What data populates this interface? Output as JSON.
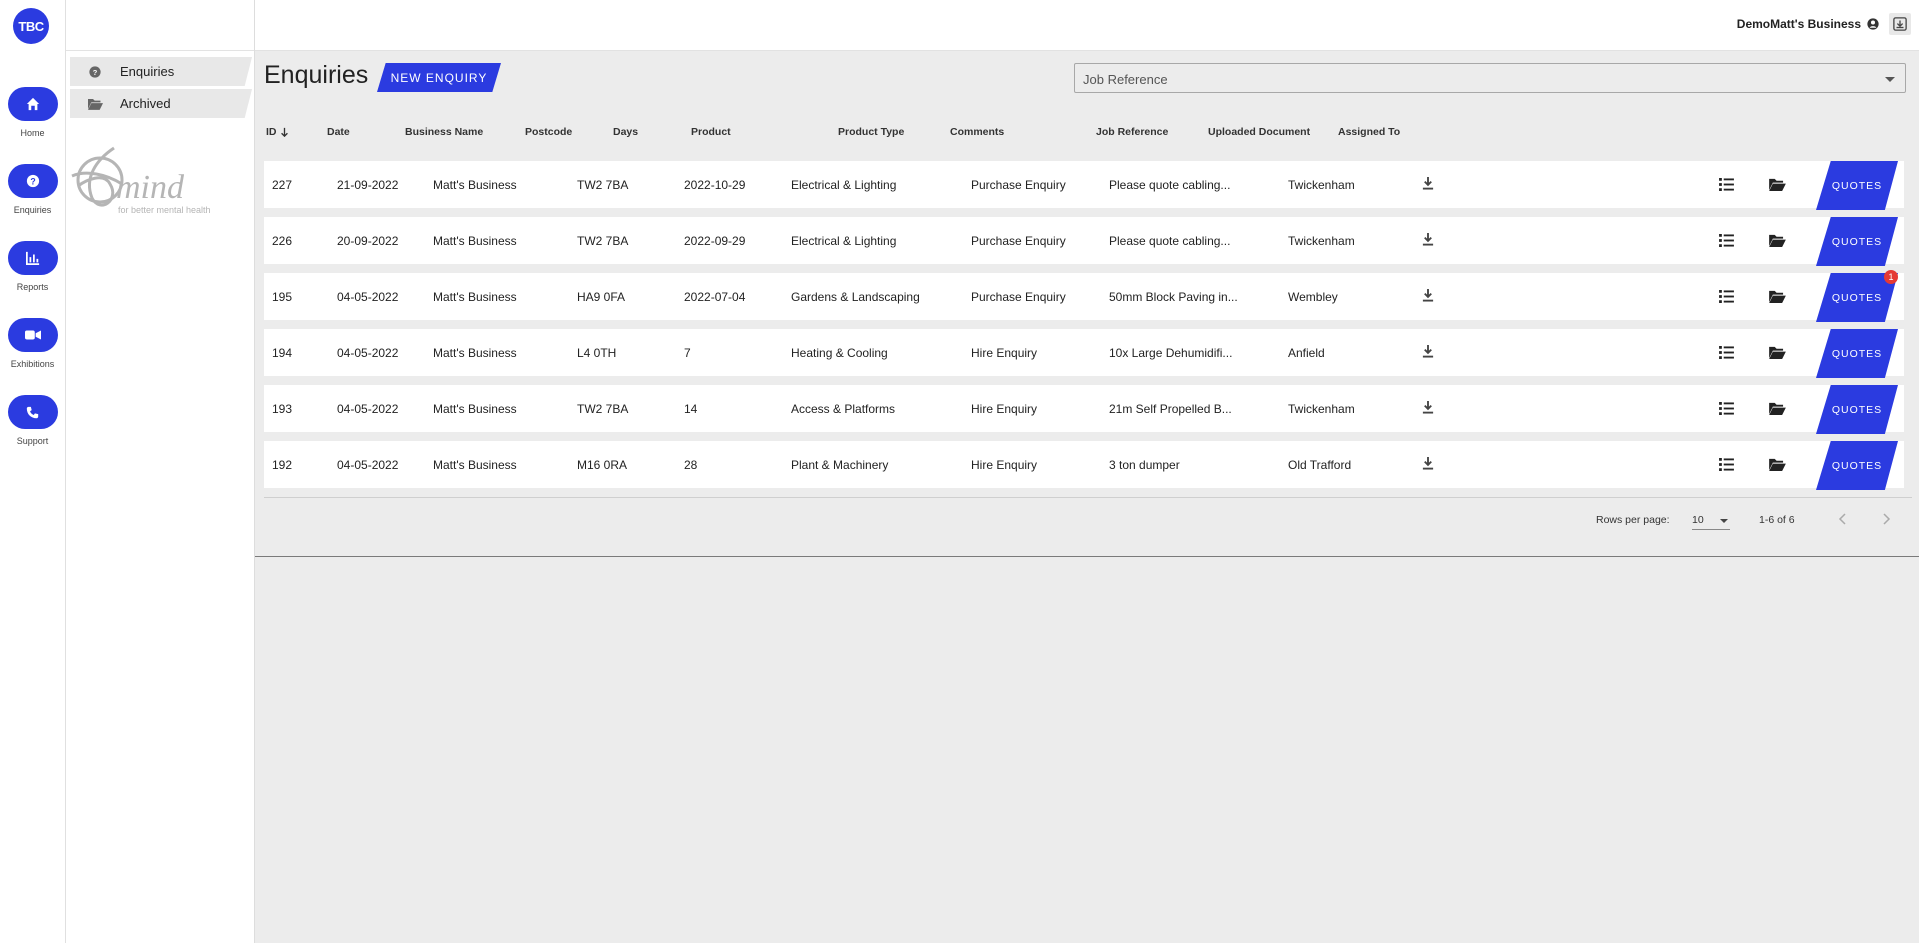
{
  "app": {
    "logo_text": "TBC"
  },
  "rail": {
    "items": [
      {
        "label": "Home",
        "icon": "home-icon"
      },
      {
        "label": "Enquiries",
        "icon": "question-icon"
      },
      {
        "label": "Reports",
        "icon": "bar-chart-icon"
      },
      {
        "label": "Exhibitions",
        "icon": "video-icon"
      },
      {
        "label": "Support",
        "icon": "phone-icon"
      }
    ]
  },
  "subnav": {
    "items": [
      {
        "label": "Enquiries",
        "icon": "question-icon"
      },
      {
        "label": "Archived",
        "icon": "folder-open-icon"
      }
    ],
    "charity_logo": {
      "name": "mind",
      "tagline": "for better mental health"
    }
  },
  "header": {
    "account_name": "DemoMatt's Business"
  },
  "main": {
    "title": "Enquiries",
    "new_button": "NEW ENQUIRY",
    "job_reference_placeholder": "Job Reference"
  },
  "table": {
    "columns": [
      "ID",
      "Date",
      "Business Name",
      "Postcode",
      "Days",
      "Product",
      "Product Type",
      "Comments",
      "Job Reference",
      "Uploaded Document",
      "Assigned To"
    ],
    "quotes_label": "QUOTES",
    "rows": [
      {
        "id": "227",
        "date": "21-09-2022",
        "business": "Matt's Business",
        "postcode": "TW2 7BA",
        "days": "2022-10-29",
        "product": "Electrical & Lighting",
        "type": "Purchase Enquiry",
        "comments": "Please quote cabling...",
        "jobref": "Twickenham",
        "badge": ""
      },
      {
        "id": "226",
        "date": "20-09-2022",
        "business": "Matt's Business",
        "postcode": "TW2 7BA",
        "days": "2022-09-29",
        "product": "Electrical & Lighting",
        "type": "Purchase Enquiry",
        "comments": "Please quote cabling...",
        "jobref": "Twickenham",
        "badge": ""
      },
      {
        "id": "195",
        "date": "04-05-2022",
        "business": "Matt's Business",
        "postcode": "HA9 0FA",
        "days": "2022-07-04",
        "product": "Gardens & Landscaping",
        "type": "Purchase Enquiry",
        "comments": "50mm Block Paving in...",
        "jobref": "Wembley",
        "badge": "1"
      },
      {
        "id": "194",
        "date": "04-05-2022",
        "business": "Matt's Business",
        "postcode": "L4 0TH",
        "days": "7",
        "product": "Heating & Cooling",
        "type": "Hire Enquiry",
        "comments": "10x Large Dehumidifi...",
        "jobref": "Anfield",
        "badge": ""
      },
      {
        "id": "193",
        "date": "04-05-2022",
        "business": "Matt's Business",
        "postcode": "TW2 7BA",
        "days": "14",
        "product": "Access & Platforms",
        "type": "Hire Enquiry",
        "comments": "21m Self Propelled B...",
        "jobref": "Twickenham",
        "badge": ""
      },
      {
        "id": "192",
        "date": "04-05-2022",
        "business": "Matt's Business",
        "postcode": "M16 0RA",
        "days": "28",
        "product": "Plant & Machinery",
        "type": "Hire Enquiry",
        "comments": "3 ton dumper",
        "jobref": "Old Trafford",
        "badge": ""
      }
    ]
  },
  "pagination": {
    "rows_per_page_label": "Rows per page:",
    "rows_per_page": "10",
    "range": "1-6 of 6"
  },
  "colors": {
    "accent": "#2b3be0",
    "badge": "#e53935",
    "background": "#ececec"
  }
}
